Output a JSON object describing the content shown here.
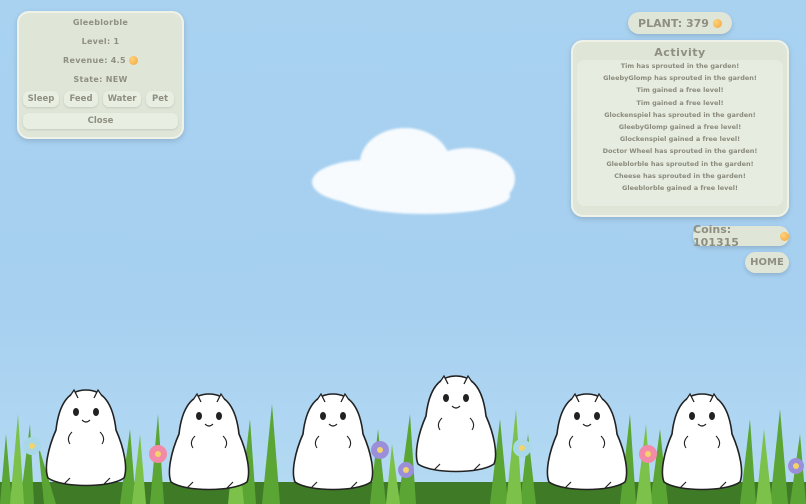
{
  "info_panel": {
    "name": "Gleeblorble",
    "level": "Level: 1",
    "revenue": "Revenue: 4.5",
    "state": "State: NEW",
    "buttons": [
      "Sleep",
      "Feed",
      "Water",
      "Pet"
    ],
    "close_label": "Close"
  },
  "plant": {
    "label": "PLANT: 379"
  },
  "activity": {
    "title": "Activity",
    "entries": [
      "Tim has sprouted in the garden!",
      "GleebyGlomp has sprouted in the garden!",
      "Tim gained a free level!",
      "Tim gained a free level!",
      "Glockenspiel has sprouted in the garden!",
      "GleebyGlomp gained a free level!",
      "Glockenspiel gained a free level!",
      "Doctor Wheel has sprouted in the garden!",
      "Gleeblorble has sprouted in the garden!",
      "Cheese has sprouted in the garden!",
      "Gleeblorble gained a free level!"
    ]
  },
  "coins": {
    "label": "Coins: 101315"
  },
  "home": {
    "label": "HOME"
  },
  "icons": {
    "currency": "coin-icon"
  },
  "colors": {
    "sky": "#a9d2f1",
    "panel": "#dfe6d8",
    "text": "#8e8f80",
    "grass": "#4f9a2c"
  }
}
